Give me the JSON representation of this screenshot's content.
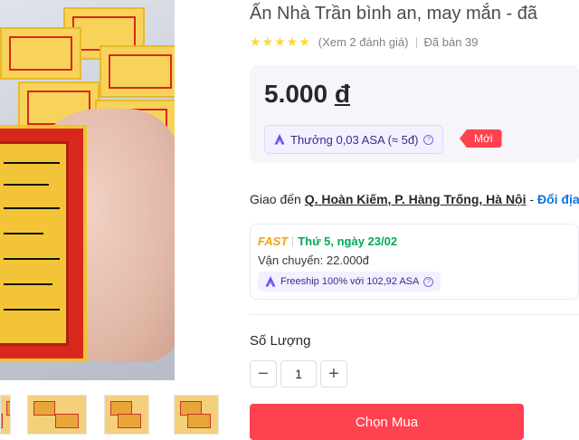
{
  "product": {
    "title": "Ấn Nhà Trần bình an, may mắn - đã",
    "rating_stars": "★★★★★",
    "reviews_text": "(Xem 2 đánh giá)",
    "sold_text": "Đã bán 39"
  },
  "price": {
    "amount": "5.000",
    "currency": "đ",
    "reward_text": "Thưởng 0,03 ASA (≈ 5đ)",
    "new_badge": "Mới"
  },
  "shipping": {
    "deliver_to_label": "Giao đến",
    "address": "Q. Hoàn Kiếm, P. Hàng Trống, Hà Nội",
    "separator": "-",
    "change_link": "Đổi địa",
    "fast_label": "FAST",
    "eta": "Thứ 5, ngày 23/02",
    "fee_text": "Vận chuyển: 22.000đ",
    "freeship_text": "Freeship 100% với 102,92 ASA"
  },
  "quantity": {
    "label": "Số Lượng",
    "value": "1",
    "minus": "−",
    "plus": "+"
  },
  "actions": {
    "buy_label": "Chọn Mua"
  },
  "icons": {
    "astra": "astra-icon",
    "info": "info-icon",
    "minus": "minus-icon",
    "plus": "plus-icon"
  },
  "colors": {
    "brand_red": "#ff424f",
    "star_yellow": "#fdd836",
    "link_blue": "#0b74e5",
    "fast_orange": "#f3a212",
    "eta_green": "#00ab56"
  }
}
